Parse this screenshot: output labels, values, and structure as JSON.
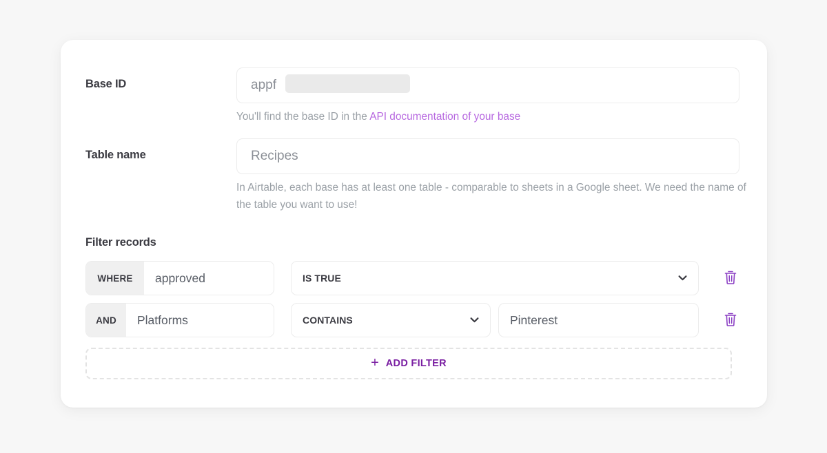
{
  "form": {
    "base_id": {
      "label": "Base ID",
      "value": "appf",
      "redacted": true,
      "helper_prefix": "You'll find the base ID in the ",
      "helper_link": "API documentation of your base"
    },
    "table_name": {
      "label": "Table name",
      "value": "Recipes",
      "helper": "In Airtable, each base has at least one table - comparable to sheets in a Google sheet. We need the name of the table you want to use!"
    }
  },
  "filters": {
    "title": "Filter records",
    "rows": [
      {
        "conjunction": "WHERE",
        "field": "approved",
        "operator": "IS TRUE",
        "value": "",
        "has_value_box": false,
        "delete_icon": "trash-icon"
      },
      {
        "conjunction": "AND",
        "field": "Platforms",
        "operator": "CONTAINS",
        "value": "Pinterest",
        "has_value_box": true,
        "delete_icon": "trash-icon"
      }
    ],
    "add_filter": {
      "plus": "+",
      "label": "ADD FILTER"
    }
  },
  "colors": {
    "accent_purple": "#7a1fa2",
    "link_purple": "#b768e0",
    "page_bg": "#f7f7f7",
    "card_bg": "#ffffff",
    "chip_bg": "#f0f0f0",
    "border": "#ececec",
    "label_text": "#3b3b42",
    "helper_text": "#9aa0a6",
    "value_text": "#585d66",
    "redaction": "#eaeaea"
  }
}
